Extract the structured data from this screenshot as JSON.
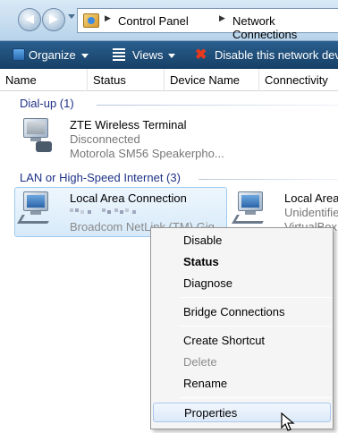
{
  "address_bar": {
    "breadcrumbs": [
      "Control Panel",
      "Network Connections"
    ]
  },
  "toolbar": {
    "organize_label": "Organize",
    "views_label": "Views",
    "disable_label": "Disable this network dev"
  },
  "columns": [
    "Name",
    "Status",
    "Device Name",
    "Connectivity"
  ],
  "groups": [
    {
      "title": "Dial-up (1)",
      "items": [
        {
          "name": "ZTE Wireless Terminal",
          "status": "Disconnected",
          "device": "Motorola SM56 Speakerpho..."
        }
      ]
    },
    {
      "title": "LAN or High-Speed Internet (3)",
      "items": [
        {
          "name": "Local Area Connection",
          "device": "Broadcom NetLink (TM) Gig..."
        },
        {
          "name": "Local Area",
          "status": "Unidentifie",
          "device": "VirtualBox"
        }
      ]
    }
  ],
  "context_menu": {
    "items": [
      "Disable",
      "Status",
      "Diagnose",
      "Bridge Connections",
      "Create Shortcut",
      "Delete",
      "Rename",
      "Properties"
    ],
    "highlighted": "Properties",
    "default_item": "Status",
    "disabled_item": "Delete"
  },
  "colors": {
    "toolbar": "#1f4f7c",
    "group_header": "#1e3287",
    "selection": "#d7eaf9"
  }
}
